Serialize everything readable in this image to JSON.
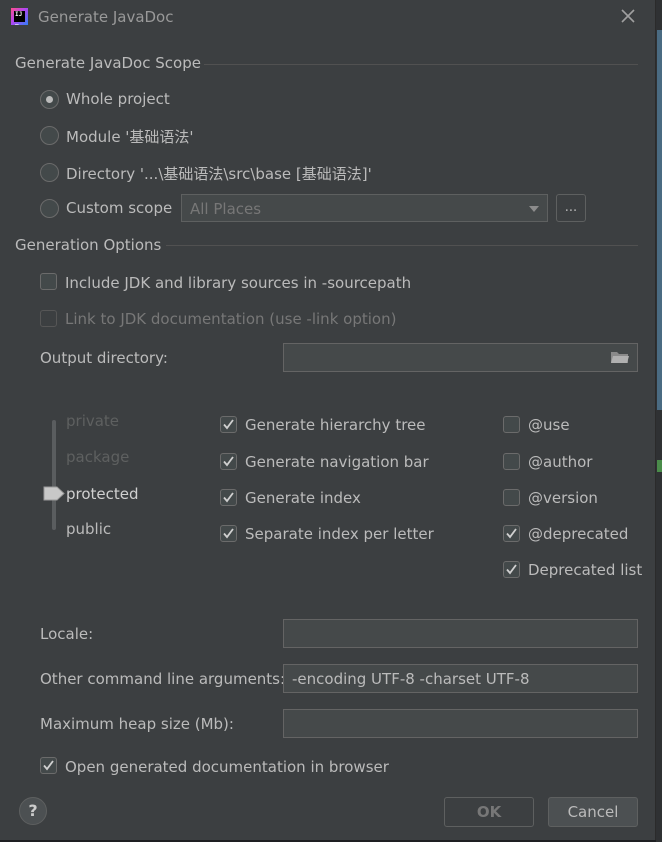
{
  "window": {
    "title": "Generate JavaDoc",
    "icon": "intellij-idea-icon"
  },
  "scope": {
    "section_title": "Generate JavaDoc Scope",
    "options": [
      {
        "label": "Whole project",
        "selected": true
      },
      {
        "label": "Module '基础语法'",
        "selected": false
      },
      {
        "label": "Directory '...\\基础语法\\src\\base [基础语法]'",
        "selected": false
      },
      {
        "label": "Custom scope",
        "selected": false
      }
    ],
    "custom_scope_value": "All Places",
    "browse_label": "..."
  },
  "generation": {
    "section_title": "Generation Options",
    "include_jdk": {
      "label": "Include JDK and library sources in -sourcepath",
      "checked": false
    },
    "link_jdk": {
      "label": "Link to JDK documentation (use -link option)",
      "checked": false,
      "enabled": false
    },
    "output_directory": {
      "label": "Output directory:",
      "value": ""
    }
  },
  "visibility": {
    "levels": [
      "private",
      "package",
      "protected",
      "public"
    ],
    "selected": "protected"
  },
  "options_mid": [
    {
      "label": "Generate hierarchy tree",
      "checked": true
    },
    {
      "label": "Generate navigation bar",
      "checked": true
    },
    {
      "label": "Generate index",
      "checked": true
    },
    {
      "label": "Separate index per letter",
      "checked": true
    }
  ],
  "options_tags": [
    {
      "label": "@use",
      "checked": false
    },
    {
      "label": "@author",
      "checked": false
    },
    {
      "label": "@version",
      "checked": false
    },
    {
      "label": "@deprecated",
      "checked": true
    },
    {
      "label": "Deprecated list",
      "checked": true
    }
  ],
  "locale": {
    "label": "Locale:",
    "value": ""
  },
  "other_args": {
    "label": "Other command line arguments:",
    "value": "-encoding UTF-8 -charset UTF-8"
  },
  "heap": {
    "label": "Maximum heap size (Mb):",
    "value": ""
  },
  "open_browser": {
    "label": "Open generated documentation in browser",
    "checked": true
  },
  "buttons": {
    "help": "?",
    "ok": "OK",
    "cancel": "Cancel"
  }
}
